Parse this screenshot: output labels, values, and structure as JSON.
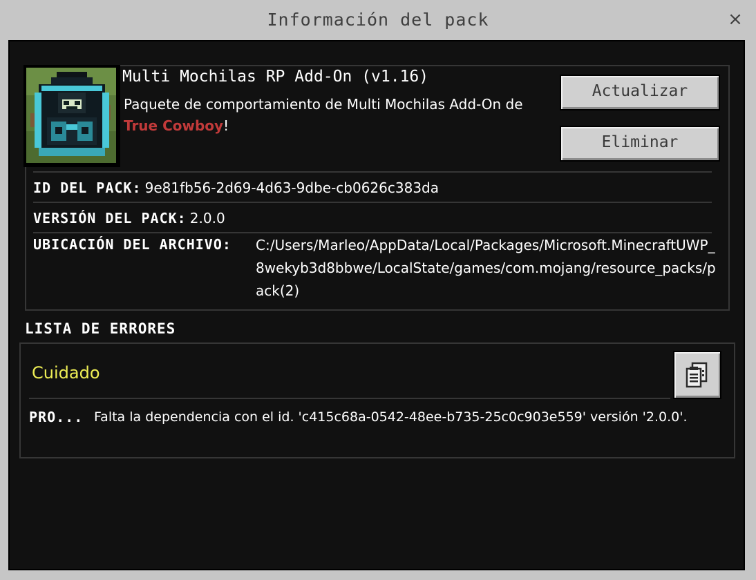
{
  "window": {
    "title": "Información del pack",
    "close_glyph": "×"
  },
  "pack": {
    "icon": "backpack-pack-icon",
    "name": "Multi Mochilas RP Add-On (v1.16)",
    "description_prefix": "Paquete de comportamiento de Multi Mochilas Add-On de ",
    "author": "True Cowboy",
    "description_suffix": "!",
    "buttons": {
      "update": "Actualizar",
      "delete": "Eliminar"
    },
    "details": {
      "id_label": "ID DEL PACK:",
      "id_value": "9e81fb56-2d69-4d63-9dbe-cb0626c383da",
      "version_label": "VERSIÓN DEL PACK:",
      "version_value": "2.0.0",
      "location_label": "UBICACIÓN DEL ARCHIVO:",
      "location_value": "C:/Users/Marleo/AppData/Local/Packages/Microsoft.MinecraftUWP_8wekyb3d8bbwe/LocalState/games/com.mojang/resource_packs/pack(2)"
    }
  },
  "errors": {
    "title": "LISTA DE ERRORES",
    "severity": "Cuidado",
    "copy_icon": "clipboard-copy-icon",
    "items": [
      {
        "code": "PRO...",
        "message": "Falta la dependencia con el id. 'c415c68a-0542-48ee-b735-25c0c903e559' versión '2.0.0'."
      }
    ]
  },
  "colors": {
    "frame": "#c6c6c6",
    "content_bg": "#111111",
    "author": "#c13a3a",
    "warning": "#eeee55",
    "button": "#d0d0d0"
  }
}
